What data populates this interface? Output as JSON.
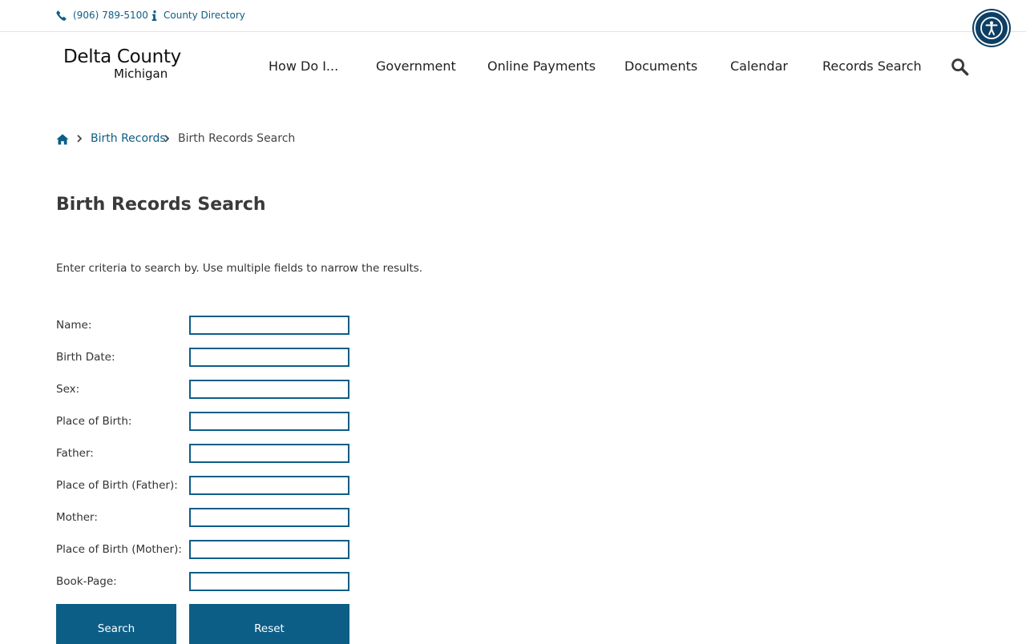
{
  "topbar": {
    "phone": "(906) 789-5100",
    "directory": "County Directory"
  },
  "logo": {
    "line1": "Delta County",
    "line2": "Michigan"
  },
  "nav": {
    "items": [
      {
        "label": "How Do I..."
      },
      {
        "label": "Government"
      },
      {
        "label": "Online Payments"
      },
      {
        "label": "Documents"
      },
      {
        "label": "Calendar"
      },
      {
        "label": "Records Search"
      }
    ]
  },
  "breadcrumb": {
    "link": "Birth Records",
    "current": "Birth Records Search"
  },
  "page": {
    "title": "Birth Records Search",
    "intro": "Enter criteria to search by. Use multiple fields to narrow the results."
  },
  "form": {
    "fields": [
      {
        "label": "Name:",
        "value": ""
      },
      {
        "label": "Birth Date:",
        "value": ""
      },
      {
        "label": "Sex:",
        "value": ""
      },
      {
        "label": "Place of Birth:",
        "value": ""
      },
      {
        "label": "Father:",
        "value": ""
      },
      {
        "label": "Place of Birth (Father):",
        "value": ""
      },
      {
        "label": "Mother:",
        "value": ""
      },
      {
        "label": "Place of Birth (Mother):",
        "value": ""
      },
      {
        "label": "Book-Page:",
        "value": ""
      }
    ],
    "search_label": "Search",
    "reset_label": "Reset"
  },
  "colors": {
    "accent": "#0c5e86",
    "a11y": "#0d3f64"
  },
  "icons": {
    "phone": "phone-icon",
    "info": "info-icon",
    "accessibility": "accessibility-icon",
    "search": "search-icon",
    "home": "home-icon",
    "chevron": "chevron-right-icon"
  }
}
